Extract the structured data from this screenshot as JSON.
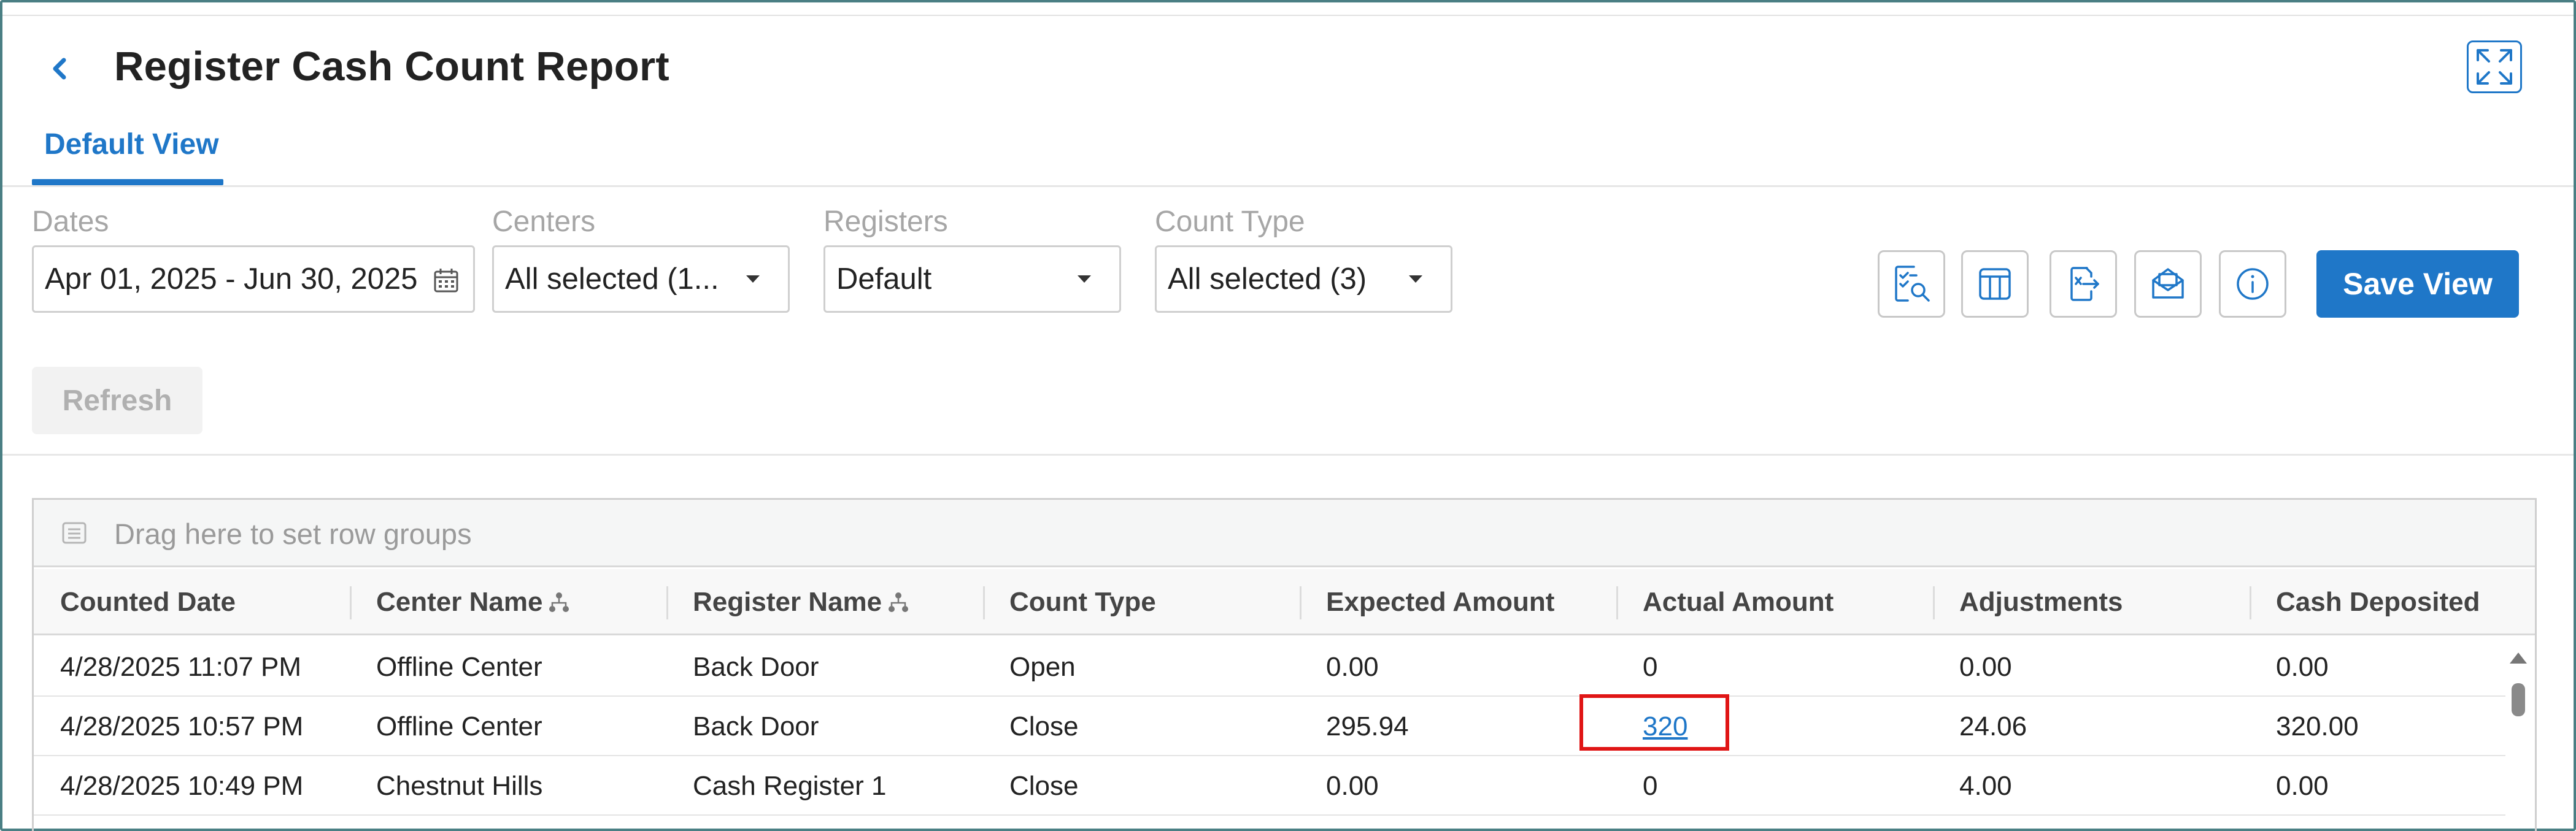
{
  "header": {
    "title": "Register Cash Count Report"
  },
  "tabs": [
    {
      "label": "Default View"
    }
  ],
  "filters": {
    "dates": {
      "label": "Dates",
      "value": "Apr 01, 2025 - Jun 30, 2025"
    },
    "centers": {
      "label": "Centers",
      "value": "All selected (1..."
    },
    "registers": {
      "label": "Registers",
      "value": "Default"
    },
    "count_type": {
      "label": "Count Type",
      "value": "All selected (3)"
    }
  },
  "toolbar": {
    "save_label": "Save View",
    "refresh_label": "Refresh"
  },
  "grid": {
    "group_bar": "Drag here to set row groups",
    "columns": [
      "Counted Date",
      "Center Name",
      "Register Name",
      "Count Type",
      "Expected Amount",
      "Actual Amount",
      "Adjustments",
      "Cash Deposited"
    ],
    "rows": [
      [
        "4/28/2025 11:07 PM",
        "Offline Center",
        "Back Door",
        "Open",
        "0.00",
        "0",
        "0.00",
        "0.00"
      ],
      [
        "4/28/2025 10:57 PM",
        "Offline Center",
        "Back Door",
        "Close",
        "295.94",
        "320",
        "24.06",
        "320.00"
      ],
      [
        "4/28/2025 10:49 PM",
        "Chestnut Hills",
        "Cash Register 1",
        "Close",
        "0.00",
        "0",
        "4.00",
        "0.00"
      ]
    ]
  },
  "colors": {
    "accent": "#1f77c8",
    "highlight": "#e01515"
  }
}
